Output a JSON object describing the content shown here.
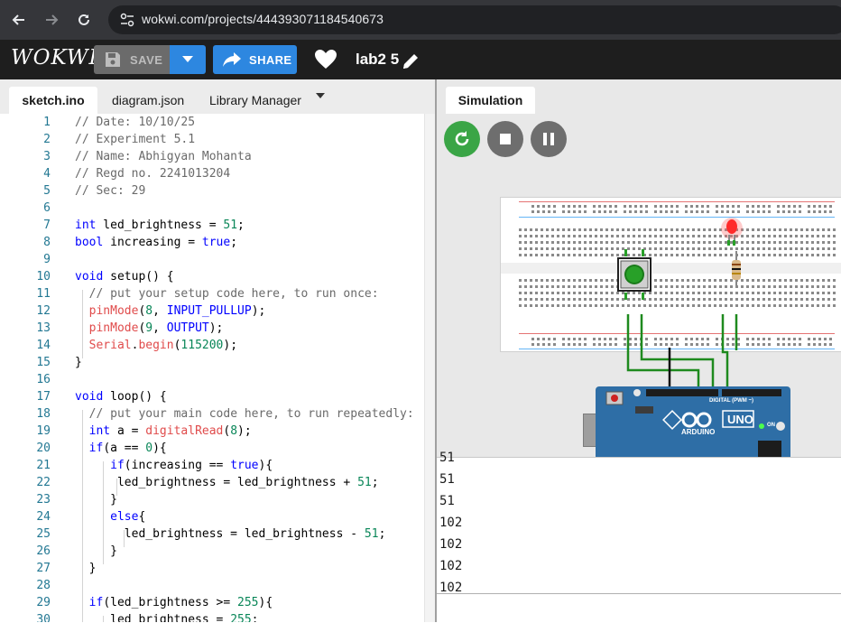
{
  "browser": {
    "url": "wokwi.com/projects/444393071184540673",
    "back_icon": "arrow-left-icon",
    "forward_icon": "arrow-right-icon",
    "reload_icon": "reload-icon"
  },
  "topbar": {
    "logo": "WOKWI",
    "save_label": "SAVE",
    "share_label": "SHARE",
    "project_name": "lab2 5"
  },
  "editor": {
    "tabs": [
      {
        "label": "sketch.ino",
        "active": true
      },
      {
        "label": "diagram.json",
        "active": false
      },
      {
        "label": "Library Manager",
        "active": false
      }
    ],
    "line_numbers": [
      "1",
      "2",
      "3",
      "4",
      "5",
      "6",
      "7",
      "8",
      "9",
      "10",
      "11",
      "12",
      "13",
      "14",
      "15",
      "16",
      "17",
      "18",
      "19",
      "20",
      "21",
      "22",
      "23",
      "24",
      "25",
      "26",
      "27",
      "28",
      "29",
      "30"
    ],
    "lines": [
      "// Date: 10/10/25",
      "// Experiment 5.1",
      "// Name: Abhigyan Mohanta",
      "// Regd no. 2241013204",
      "// Sec: 29",
      "",
      "int led_brightness = 51;",
      "bool increasing = true;",
      "",
      "void setup() {",
      "  // put your setup code here, to run once:",
      "  pinMode(8, INPUT_PULLUP);",
      "  pinMode(9, OUTPUT);",
      "  Serial.begin(115200);",
      "}",
      "",
      "void loop() {",
      "  // put your main code here, to run repeatedly:",
      "  int a = digitalRead(8);",
      "  if(a == 0){",
      "     if(increasing == true){",
      "      led_brightness = led_brightness + 51;",
      "     }",
      "     else{",
      "       led_brightness = led_brightness - 51;",
      "     }",
      "  }",
      "",
      "  if(led_brightness >= 255){",
      "     led_brightness = 255;"
    ]
  },
  "simulation": {
    "tab_label": "Simulation",
    "board_label": "UNO",
    "board_brand": "ARDUINO",
    "board_header": "DIGITAL (PWM ~)",
    "on_label": "ON",
    "serial_output": [
      "51",
      "51",
      "51",
      "102",
      "102",
      "102",
      "102"
    ],
    "colors": {
      "restart": "#3aa546",
      "led": "#ff2a2a",
      "wire": "#1e8a1e",
      "board": "#2e6ea6"
    }
  }
}
